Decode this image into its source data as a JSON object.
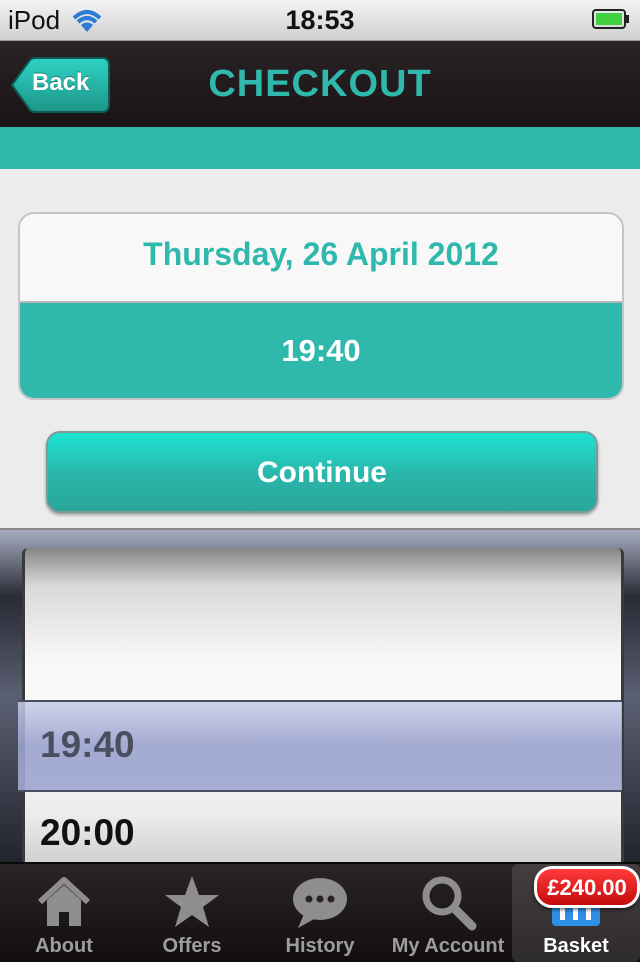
{
  "status_bar": {
    "carrier": "iPod",
    "time": "18:53"
  },
  "nav": {
    "back_label": "Back",
    "title": "CHECKOUT"
  },
  "booking": {
    "date": "Thursday, 26 April 2012",
    "time": "19:40"
  },
  "continue_label": "Continue",
  "picker": {
    "selected": "19:40",
    "next": "20:00"
  },
  "tabs": [
    {
      "label": "About",
      "icon": "house-icon"
    },
    {
      "label": "Offers",
      "icon": "star-icon"
    },
    {
      "label": "History",
      "icon": "speech-bubble-icon"
    },
    {
      "label": "My Account",
      "icon": "magnifier-icon"
    },
    {
      "label": "Basket",
      "icon": "basket-icon",
      "active": true
    }
  ],
  "basket_total": "£240.00",
  "colors": {
    "accent": "#2fb8ac",
    "nav_background": "#1e1719",
    "badge": "#d61a1a"
  }
}
